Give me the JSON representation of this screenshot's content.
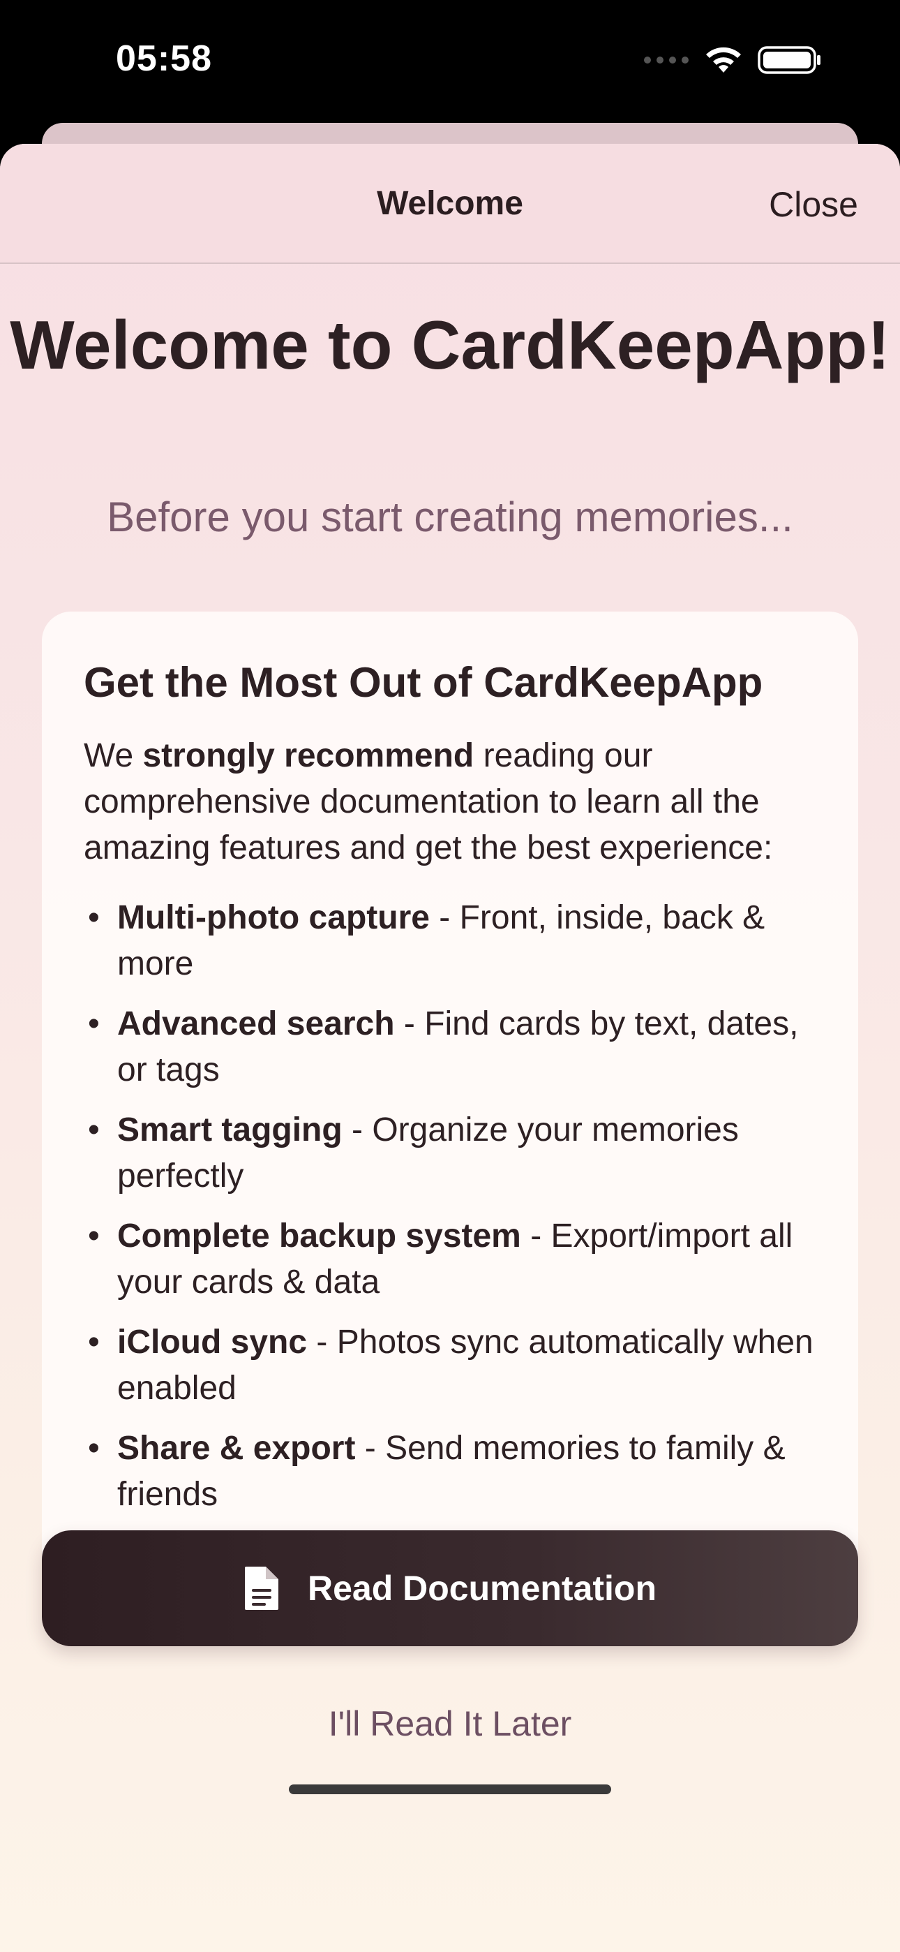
{
  "status_bar": {
    "time": "05:58",
    "icons": [
      "cellular-dots-icon",
      "wifi-icon",
      "battery-icon"
    ]
  },
  "nav": {
    "title": "Welcome",
    "close_label": "Close"
  },
  "hero": {
    "title": "Welcome to CardKeepApp!",
    "subtitle": "Before you start creating memories..."
  },
  "card": {
    "title": "Get the Most Out of CardKeepApp",
    "intro_before": "We ",
    "intro_bold": "strongly recommend",
    "intro_after": " reading our comprehensive documentation to learn all the amazing features and get the best experience:",
    "features": [
      {
        "name": "Multi-photo capture",
        "description": " - Front, inside, back & more"
      },
      {
        "name": "Advanced search",
        "description": " - Find cards by text, dates, or tags"
      },
      {
        "name": "Smart tagging",
        "description": " - Organize your memories perfectly"
      },
      {
        "name": "Complete backup system",
        "description": " - Export/import all your cards & data"
      },
      {
        "name": "iCloud sync",
        "description": " - Photos sync automatically when enabled"
      },
      {
        "name": "Share & export",
        "description": " - Send memories to family & friends"
      }
    ]
  },
  "actions": {
    "primary_label": "Read Documentation",
    "primary_icon": "document-icon",
    "secondary_label": "I'll Read It Later"
  },
  "colors": {
    "primary_button": "#2e1e22",
    "accent_text": "#7a5a6c",
    "sheet_background": "#f7dfe3"
  }
}
